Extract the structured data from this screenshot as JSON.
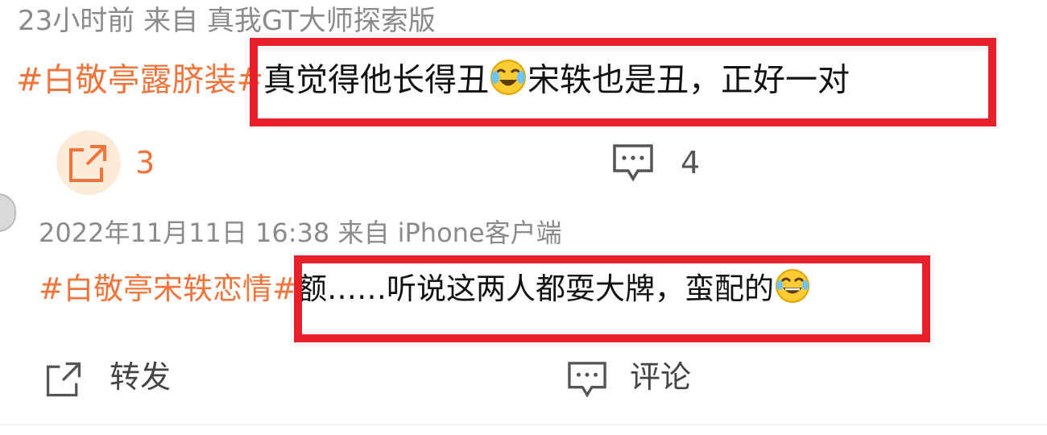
{
  "post1": {
    "meta": "23小时前  来自  真我GT大师探索版",
    "hashtag": "#白敬亭露脐装#",
    "text_a": "真觉得他长得丑",
    "text_b": "宋轶也是丑，正好一对",
    "emoji_icon": "laughing-crying-emoji-icon",
    "repost_count": "3",
    "comment_count": "4"
  },
  "post2": {
    "meta": "2022年11月11日  16:38  来自  iPhone客户端",
    "hashtag": "#白敬亭宋轶恋情#",
    "text": "额……听说这两人都耍大牌，蛮配的",
    "emoji_icon": "tears-of-joy-emoji-icon",
    "repost_label": "转发",
    "comment_label": "评论"
  },
  "colors": {
    "hashtag": "#f0743b",
    "highlight_box": "#e8202a",
    "meta_text": "#8a8a8a",
    "icon_gray": "#555555"
  }
}
